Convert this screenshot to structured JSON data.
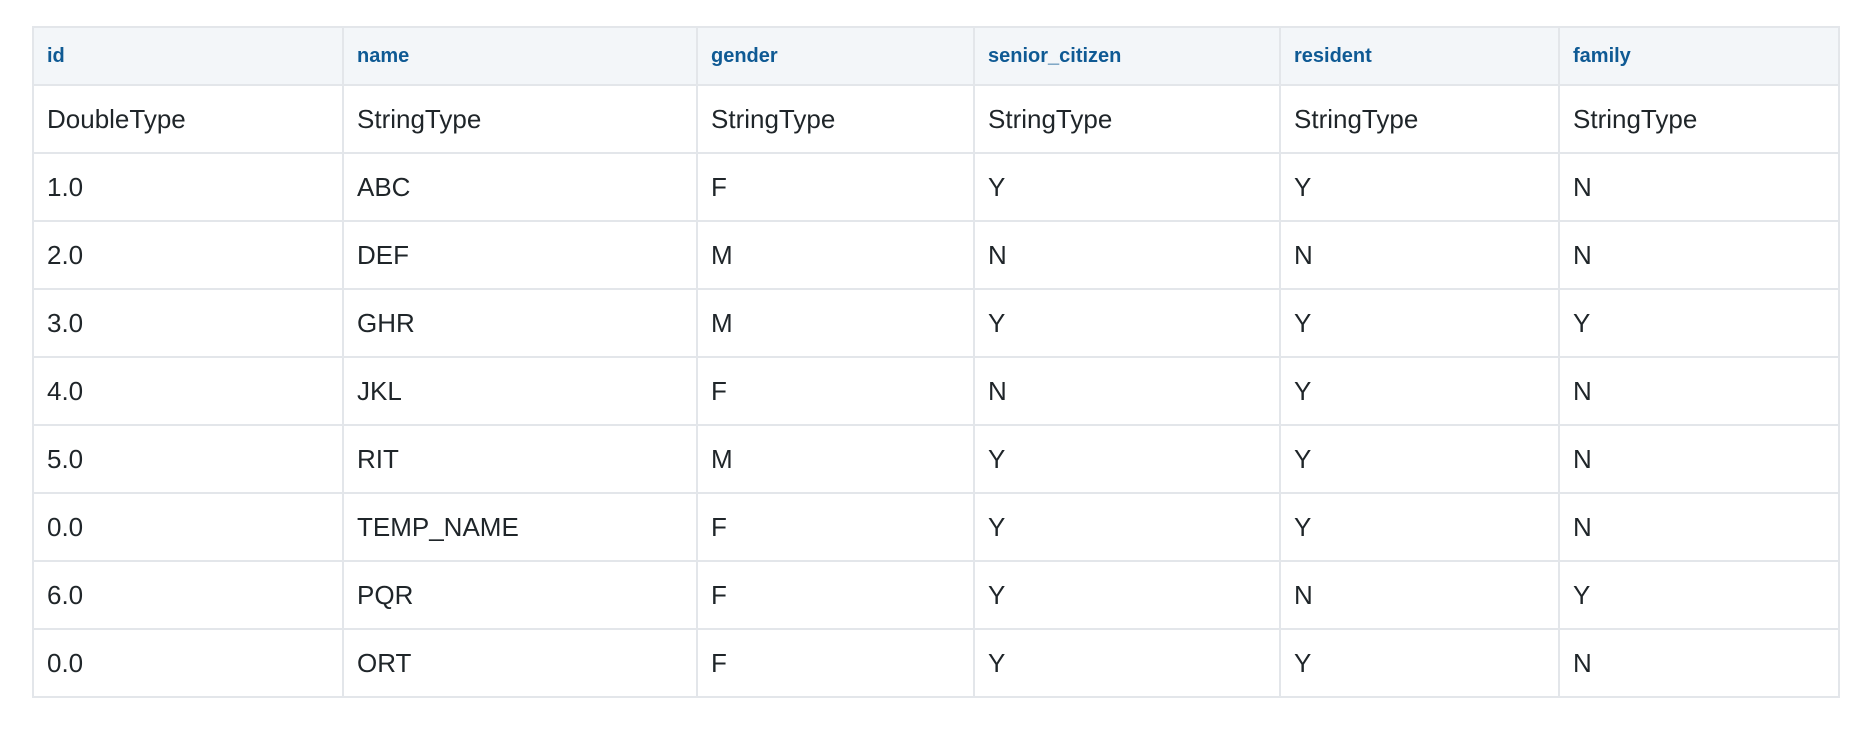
{
  "columns": [
    "id",
    "name",
    "gender",
    "senior_citizen",
    "resident",
    "family"
  ],
  "types": [
    "DoubleType",
    "StringType",
    "StringType",
    "StringType",
    "StringType",
    "StringType"
  ],
  "rows": [
    [
      "1.0",
      "ABC",
      "F",
      "Y",
      "Y",
      "N"
    ],
    [
      "2.0",
      "DEF",
      "M",
      "N",
      "N",
      "N"
    ],
    [
      "3.0",
      "GHR",
      "M",
      "Y",
      "Y",
      "Y"
    ],
    [
      "4.0",
      "JKL",
      "F",
      "N",
      "Y",
      "N"
    ],
    [
      "5.0",
      "RIT",
      "M",
      "Y",
      "Y",
      "N"
    ],
    [
      "0.0",
      "TEMP_NAME",
      "F",
      "Y",
      "Y",
      "N"
    ],
    [
      "6.0",
      "PQR",
      "F",
      "Y",
      "N",
      "Y"
    ],
    [
      "0.0",
      "ORT",
      "F",
      "Y",
      "Y",
      "N"
    ]
  ],
  "colors": {
    "header_text": "#0f5a94",
    "header_bg": "#f3f6f9",
    "border": "#e3e6ea",
    "cell_text": "#1f2529"
  }
}
